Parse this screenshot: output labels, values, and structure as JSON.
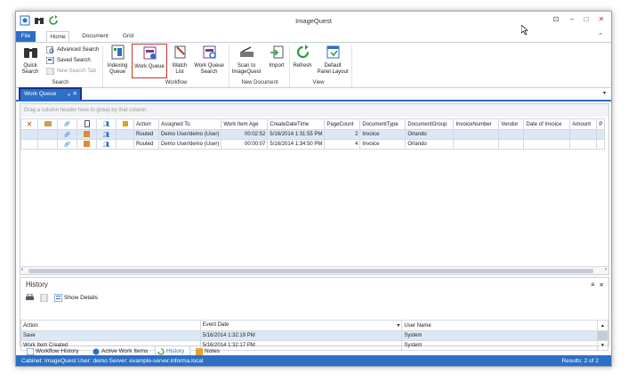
{
  "window": {
    "title": "ImageQuest"
  },
  "tabs": [
    "File",
    "Home",
    "Document",
    "Grid"
  ],
  "ribbon": {
    "quick_search": "Quick Search",
    "advanced_search": "Advanced Search",
    "saved_search": "Saved Search",
    "new_search_tab": "New Search Tab",
    "search_group": "Search",
    "indexing_queue": "Indexing Queue",
    "work_queue": "Work Queue",
    "watch_list": "Watch List",
    "work_queue_search": "Work Queue Search",
    "workflow_group": "Workflow",
    "scan_to": "Scan to ImageQuest",
    "import": "Import",
    "new_document_group": "New Document",
    "refresh": "Refresh",
    "default_panel_layout": "Default Panel Layout",
    "view_group": "View"
  },
  "doc_tab": {
    "label": "Work Queue"
  },
  "grid": {
    "group_hint": "Drag a column header here to group by that column",
    "columns": [
      "Action",
      "Assigned To",
      "Work Item Age",
      "CreateDateTime",
      "PageCount",
      "DocumentType",
      "DocumentGroup",
      "InvoiceNumber",
      "Vendor",
      "Date of Invoice",
      "Amount",
      "P"
    ],
    "rows": [
      {
        "action": "Routed",
        "assigned": "Demo User/demo (User)",
        "age": "00:02:52",
        "created": "5/16/2014 1:31:55 PM",
        "pages": "2",
        "type": "Invoice",
        "group": "Orlando"
      },
      {
        "action": "Routed",
        "assigned": "Demo User/demo (User)",
        "age": "00:00:07",
        "created": "5/16/2014 1:34:50 PM",
        "pages": "4",
        "type": "Invoice",
        "group": "Orlando"
      }
    ]
  },
  "history": {
    "title": "History",
    "pin": "a",
    "show_details": "Show Details",
    "columns": [
      "Action",
      "Event Date",
      "User Name"
    ],
    "rows": [
      {
        "action": "Save",
        "date": "5/16/2014 1:32:19 PM",
        "user": "System"
      },
      {
        "action": "Work Item Created",
        "date": "5/16/2014 1:32:17 PM",
        "user": "System"
      }
    ]
  },
  "bottom_tabs": [
    "Workflow History",
    "Active Work Items",
    "History",
    "Notes"
  ],
  "status": {
    "text": "Cabinet: ImageQuest  User: demo  Server: example-server.informa.local",
    "results": "Results: 2 of 2"
  }
}
